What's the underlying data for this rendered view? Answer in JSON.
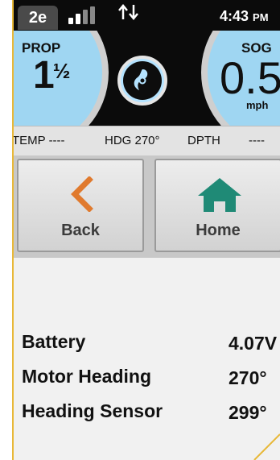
{
  "status_bar": {
    "screen_id": "2e",
    "signal_icon": "signal-bars-icon",
    "sync_icon": "up-down-arrows-icon",
    "time": "4:43",
    "ampm": "PM"
  },
  "gauges": {
    "prop": {
      "label": "PROP",
      "value": "1",
      "fraction": "½"
    },
    "sog": {
      "label": "SOG",
      "value": "0.5",
      "unit": "mph"
    },
    "center_icon": "propeller-icon"
  },
  "info_strip": {
    "temp": "TEMP ----",
    "heading": "HDG 270°",
    "depth": "DPTH",
    "depth_value": "----"
  },
  "nav": {
    "back_label": "Back",
    "home_label": "Home",
    "back_color": "#e07a2e",
    "home_color": "#1f8a76"
  },
  "readings": [
    {
      "name": "Battery",
      "value": "4.07V"
    },
    {
      "name": "Motor Heading",
      "value": "270°"
    },
    {
      "name": "Heading Sensor",
      "value": "299°"
    }
  ],
  "colors": {
    "gauge_blue": "#9fd6f2",
    "frame_gold": "#e8b838"
  }
}
